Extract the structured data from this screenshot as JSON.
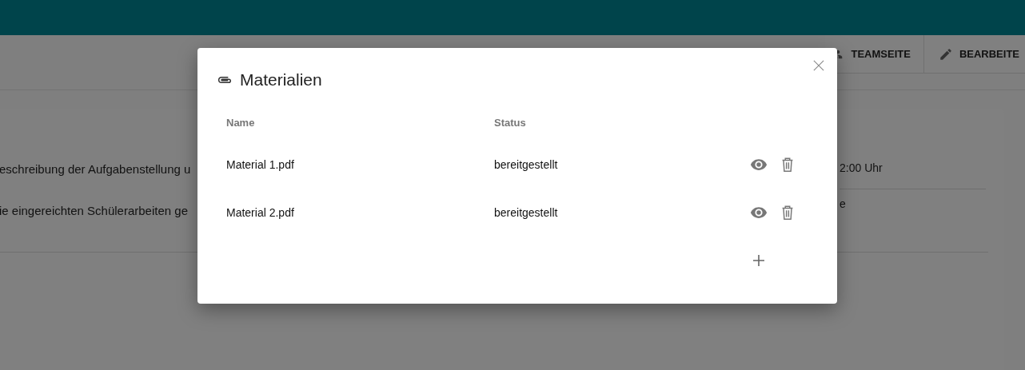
{
  "toolbar": {
    "buttons": [
      {
        "kind": "team",
        "label": "TEAMSEITE"
      },
      {
        "kind": "edit",
        "label": "BEARBEITE"
      }
    ]
  },
  "background_card": {
    "description_lines": [
      "eschreibung der Aufgabenstellung u",
      "ie eingereichten Schülerarbeiten ge"
    ],
    "side_lines": [
      "2:00 Uhr",
      "e"
    ]
  },
  "dialog": {
    "title": "Materialien",
    "columns": [
      "Name",
      "Status"
    ],
    "rows": [
      {
        "name": "Material 1.pdf",
        "status": "bereitgestellt"
      },
      {
        "name": "Material 2.pdf",
        "status": "bereitgestellt"
      }
    ]
  }
}
